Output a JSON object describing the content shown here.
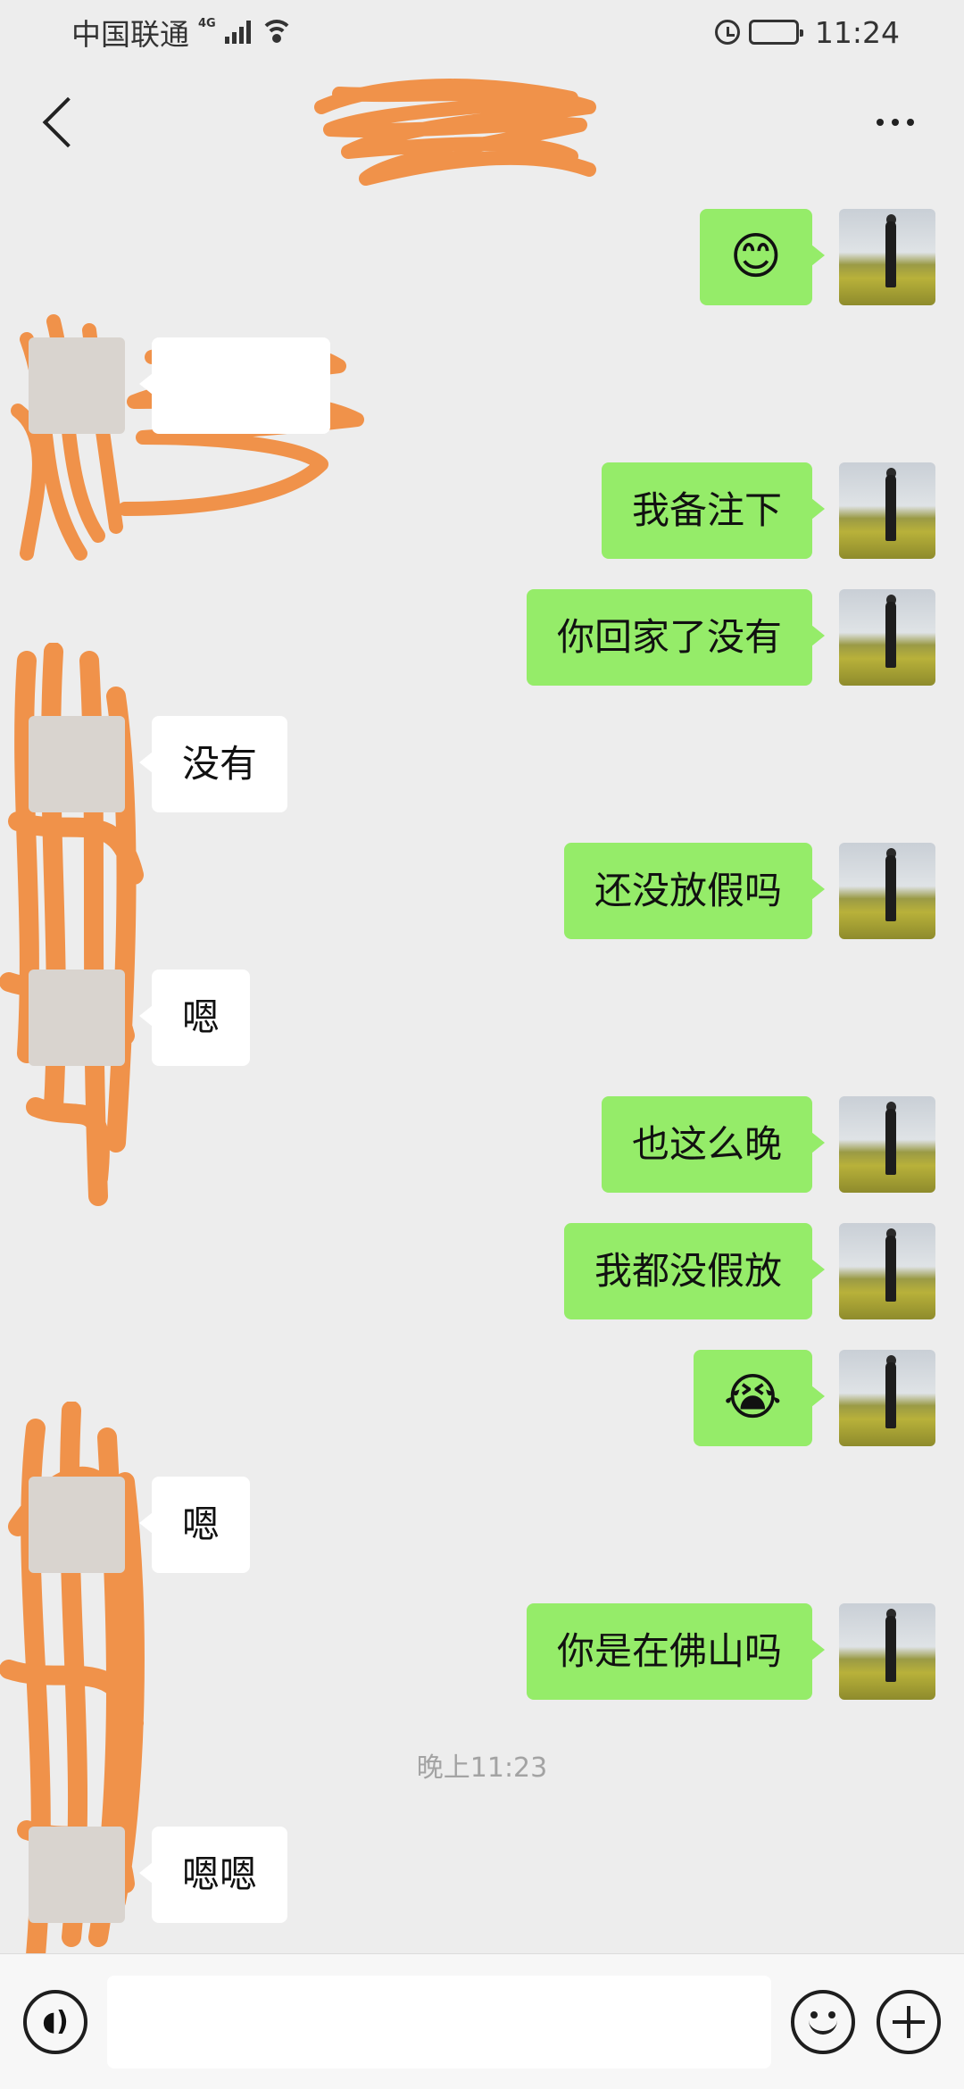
{
  "status_bar": {
    "carrier": "中国联通",
    "network": "4G",
    "time": "11:24"
  },
  "nav": {
    "title": "",
    "back_icon": "chevron-left-icon",
    "more_icon": "more-dots-icon"
  },
  "messages": [
    {
      "direction": "out",
      "type": "emoji",
      "text": "😊"
    },
    {
      "direction": "in",
      "type": "text",
      "text": ""
    },
    {
      "direction": "out",
      "type": "text",
      "text": "我备注下"
    },
    {
      "direction": "out",
      "type": "text",
      "text": "你回家了没有"
    },
    {
      "direction": "in",
      "type": "text",
      "text": "没有"
    },
    {
      "direction": "out",
      "type": "text",
      "text": "还没放假吗"
    },
    {
      "direction": "in",
      "type": "text",
      "text": "嗯"
    },
    {
      "direction": "out",
      "type": "text",
      "text": "也这么晚"
    },
    {
      "direction": "out",
      "type": "text",
      "text": "我都没假放"
    },
    {
      "direction": "out",
      "type": "emoji",
      "text": "😭"
    },
    {
      "direction": "in",
      "type": "text",
      "text": "嗯"
    },
    {
      "direction": "out",
      "type": "text",
      "text": "你是在佛山吗"
    },
    {
      "direction": "in",
      "type": "text",
      "text": "嗯嗯"
    }
  ],
  "timestamp": "晚上11:23",
  "input_bar": {
    "voice_icon": "voice-icon",
    "input_value": "",
    "emoji_icon": "emoji-icon",
    "plus_icon": "plus-icon"
  },
  "colors": {
    "background": "#ededed",
    "outgoing_bubble": "#95ec69",
    "incoming_bubble": "#ffffff",
    "scribble": "#f0924a"
  }
}
